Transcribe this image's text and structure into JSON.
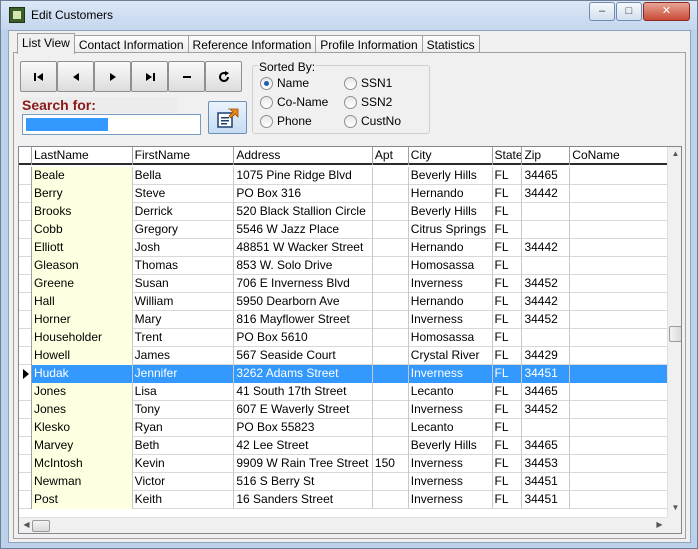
{
  "window": {
    "title": "Edit Customers",
    "min_glyph": "–",
    "max_glyph": "□",
    "close_glyph": "✕"
  },
  "tabs": [
    {
      "label": "List View",
      "active": true
    },
    {
      "label": "Contact Information",
      "active": false
    },
    {
      "label": "Reference Information",
      "active": false
    },
    {
      "label": "Profile Information",
      "active": false
    },
    {
      "label": "Statistics",
      "active": false
    }
  ],
  "navigator": {
    "buttons": [
      "first-record-icon",
      "prior-record-icon",
      "next-record-icon",
      "last-record-icon",
      "delete-record-icon",
      "refresh-icon"
    ]
  },
  "search": {
    "label": "Search for:",
    "value": "",
    "button_icon": "search-go-icon"
  },
  "sort": {
    "title": "Sorted By:",
    "options": [
      {
        "label": "Name",
        "checked": true
      },
      {
        "label": "Co-Name",
        "checked": false
      },
      {
        "label": "Phone",
        "checked": false
      },
      {
        "label": "SSN1",
        "checked": false
      },
      {
        "label": "SSN2",
        "checked": false
      },
      {
        "label": "CustNo",
        "checked": false
      }
    ]
  },
  "grid": {
    "columns": [
      "LastName",
      "FirstName",
      "Address",
      "Apt",
      "City",
      "State",
      "Zip",
      "CoName"
    ],
    "selected_row": 11,
    "rows": [
      [
        "Beale",
        "Bella",
        "1075 Pine Ridge Blvd",
        "",
        "Beverly Hills",
        "FL",
        "34465",
        ""
      ],
      [
        "Berry",
        "Steve",
        "PO Box 316",
        "",
        "Hernando",
        "FL",
        "34442",
        ""
      ],
      [
        "Brooks",
        "Derrick",
        "520 Black Stallion Circle",
        "",
        "Beverly Hills",
        "FL",
        "",
        ""
      ],
      [
        "Cobb",
        "Gregory",
        "5546 W Jazz Place",
        "",
        "Citrus Springs",
        "FL",
        "",
        ""
      ],
      [
        "Elliott",
        "Josh",
        "48851 W Wacker Street",
        "",
        "Hernando",
        "FL",
        "34442",
        ""
      ],
      [
        "Gleason",
        "Thomas",
        "853 W. Solo Drive",
        "",
        "Homosassa",
        "FL",
        "",
        ""
      ],
      [
        "Greene",
        "Susan",
        "706 E Inverness Blvd",
        "",
        "Inverness",
        "FL",
        "34452",
        ""
      ],
      [
        "Hall",
        "William",
        "5950 Dearborn Ave",
        "",
        "Hernando",
        "FL",
        "34442",
        ""
      ],
      [
        "Horner",
        "Mary",
        "816 Mayflower Street",
        "",
        "Inverness",
        "FL",
        "34452",
        ""
      ],
      [
        "Householder",
        "Trent",
        "PO Box 5610",
        "",
        "Homosassa",
        "FL",
        "",
        ""
      ],
      [
        "Howell",
        "James",
        "567 Seaside Court",
        "",
        "Crystal River",
        "FL",
        "34429",
        ""
      ],
      [
        "Hudak",
        "Jennifer",
        "3262 Adams Street",
        "",
        "Inverness",
        "FL",
        "34451",
        ""
      ],
      [
        "Jones",
        "Lisa",
        "41 South 17th Street",
        "",
        "Lecanto",
        "FL",
        "34465",
        ""
      ],
      [
        "Jones",
        "Tony",
        "607 E Waverly Street",
        "",
        "Inverness",
        "FL",
        "34452",
        ""
      ],
      [
        "Klesko",
        "Ryan",
        "PO Box 55823",
        "",
        "Lecanto",
        "FL",
        "",
        ""
      ],
      [
        "Marvey",
        "Beth",
        "42 Lee Street",
        "",
        "Beverly Hills",
        "FL",
        "34465",
        ""
      ],
      [
        "McIntosh",
        "Kevin",
        "9909 W Rain Tree Street",
        "150",
        "Inverness",
        "FL",
        "34453",
        ""
      ],
      [
        "Newman",
        "Victor",
        "516 S Berry St",
        "",
        "Inverness",
        "FL",
        "34451",
        ""
      ],
      [
        "Post",
        "Keith",
        "16 Sanders Street",
        "",
        "Inverness",
        "FL",
        "34451",
        ""
      ]
    ]
  }
}
